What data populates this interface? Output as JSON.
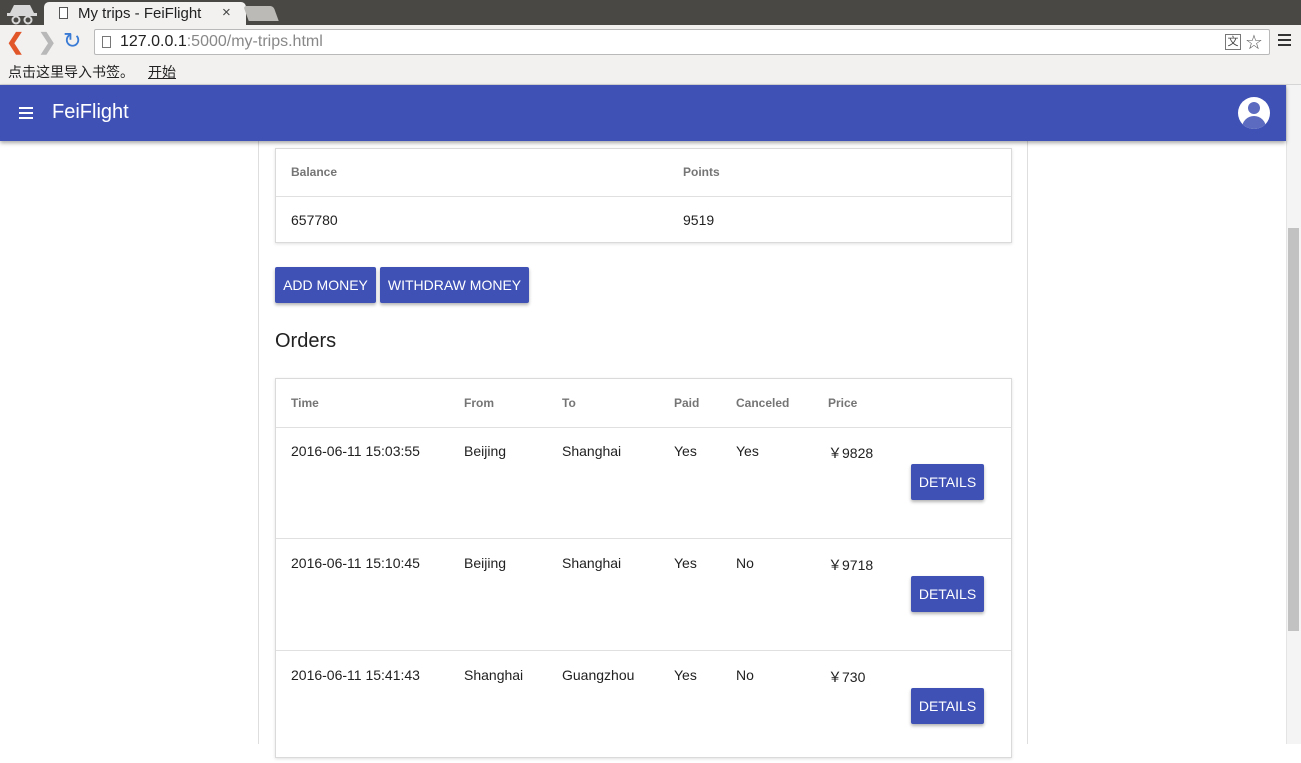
{
  "browser": {
    "tab_title": "My trips - FeiFlight",
    "tab_close": "×",
    "url_host": "127.0.0.1",
    "url_path": ":5000/my-trips.html",
    "bookmarks_prompt": "点击这里导入书签。",
    "bookmarks_link": "开始"
  },
  "app": {
    "title": "FeiFlight"
  },
  "account": {
    "headers": {
      "balance": "Balance",
      "points": "Points"
    },
    "balance": "657780",
    "points": "9519"
  },
  "actions": {
    "add_money": "ADD MONEY",
    "withdraw_money": "WITHDRAW MONEY"
  },
  "orders": {
    "title": "Orders",
    "headers": {
      "time": "Time",
      "from": "From",
      "to": "To",
      "paid": "Paid",
      "canceled": "Canceled",
      "price": "Price"
    },
    "details_label": "DETAILS",
    "rows": [
      {
        "time": "2016-06-11 15:03:55",
        "from": "Beijing",
        "to": "Shanghai",
        "paid": "Yes",
        "canceled": "Yes",
        "price": "￥9828"
      },
      {
        "time": "2016-06-11 15:10:45",
        "from": "Beijing",
        "to": "Shanghai",
        "paid": "Yes",
        "canceled": "No",
        "price": "￥9718"
      },
      {
        "time": "2016-06-11 15:41:43",
        "from": "Shanghai",
        "to": "Guangzhou",
        "paid": "Yes",
        "canceled": "No",
        "price": "￥730"
      }
    ]
  },
  "colors": {
    "primary": "#3f51b5",
    "tabbar": "#4a4844",
    "chrome": "#f2f1f0"
  }
}
